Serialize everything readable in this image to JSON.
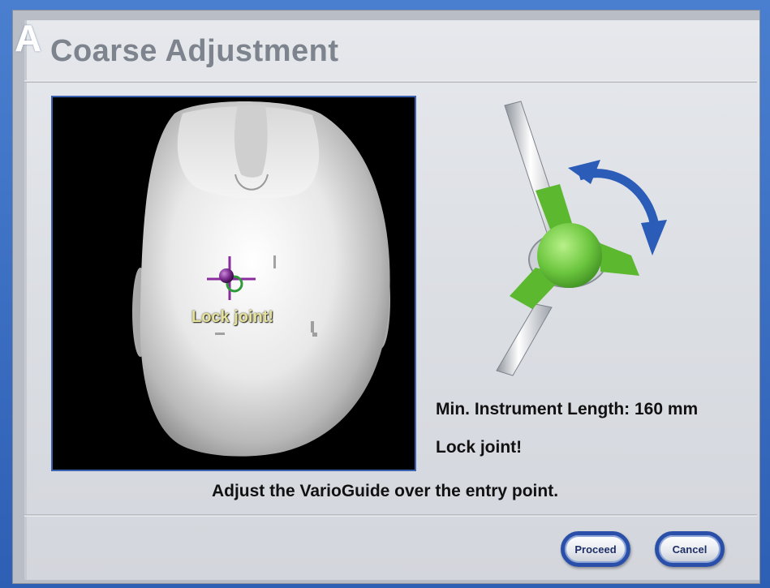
{
  "figure_label": "A",
  "dialog": {
    "title": "Coarse Adjustment",
    "viewport_overlay_label": "Lock joint!",
    "min_instrument_length": "Min. Instrument Length: 160 mm",
    "status": "Lock joint!",
    "instruction": "Adjust the VarioGuide over the entry point."
  },
  "buttons": {
    "proceed": "Proceed",
    "cancel": "Cancel"
  },
  "icons": {
    "target": "crosshair-target-icon",
    "joint": "varioguide-joint-icon",
    "rotate": "rotate-arrow-icon"
  },
  "colors": {
    "accent_blue": "#2a5cb8",
    "joint_green": "#66c23a",
    "target_purple": "#7a2b8f",
    "overlay_text": "#e6e19a"
  }
}
